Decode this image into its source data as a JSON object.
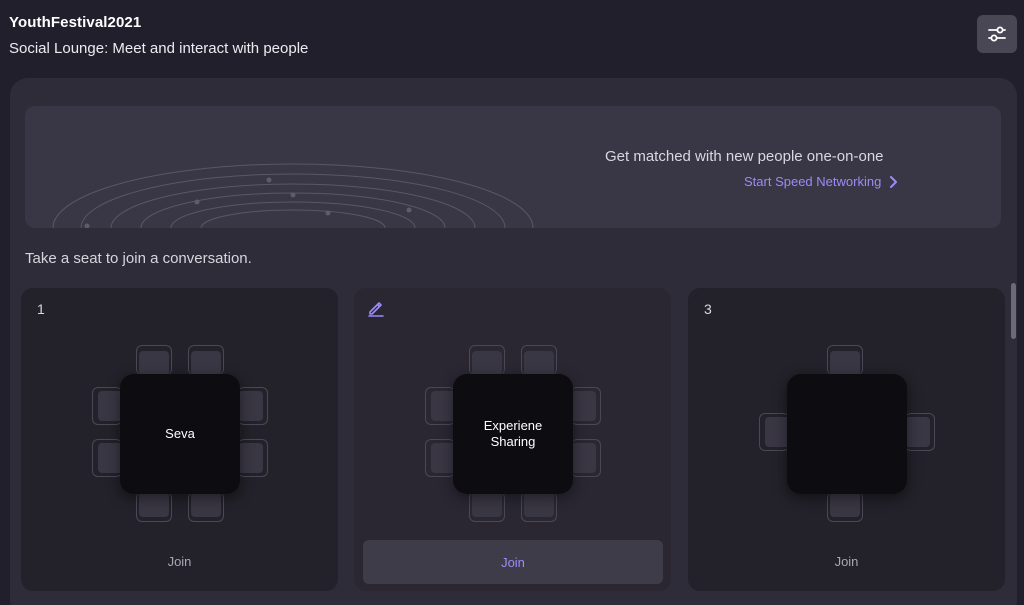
{
  "header": {
    "event_name": "YouthFestival2021",
    "subtitle": "Social Lounge: Meet and interact with people"
  },
  "banner": {
    "text": "Get matched with new people one-on-one",
    "link_label": "Start Speed Networking"
  },
  "prompt": "Take a seat to join a conversation.",
  "tables": [
    {
      "number": "1",
      "name": "Seva",
      "join_label": "Join"
    },
    {
      "name_line1": "Experiene",
      "name_line2": "Sharing",
      "join_label": "Join"
    },
    {
      "number": "3",
      "name": "",
      "join_label": "Join"
    }
  ],
  "colors": {
    "background": "#221f2d",
    "panel": "#2f2c3a",
    "accent": "#9b8cf6",
    "table_top": "#0d0c10"
  },
  "icons": [
    "settings-sliders-icon",
    "chevron-right-icon",
    "edit-pencil-icon"
  ]
}
